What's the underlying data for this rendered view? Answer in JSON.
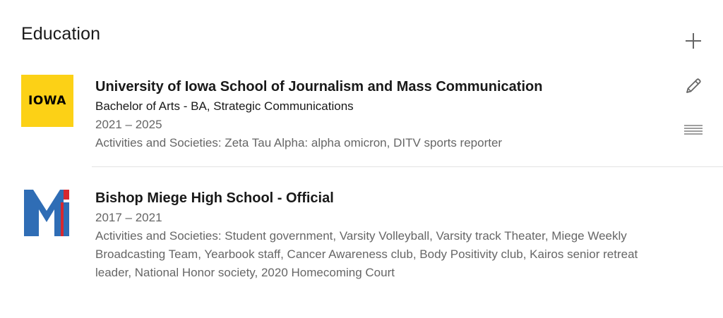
{
  "section": {
    "title": "Education"
  },
  "actions": {
    "add_icon": "plus-icon",
    "edit_icon": "pencil-icon",
    "reorder_icon": "drag-handle-icon"
  },
  "education": [
    {
      "logo_text": "IOWA",
      "logo_color": "#fcd116",
      "school": "University of Iowa School of Journalism and Mass Communication",
      "degree": "Bachelor of Arts - BA, Strategic Communications",
      "dates": "2021 – 2025",
      "activities": "Activities and Societies: Zeta Tau Alpha: alpha omicron, DITV sports reporter"
    },
    {
      "logo_colors": [
        "#2f6db5",
        "#d7282f"
      ],
      "school": "Bishop Miege High School - Official",
      "dates": "2017 – 2021",
      "activities": "Activities and Societies: Student government, Varsity Volleyball, Varsity track Theater, Miege Weekly Broadcasting Team, Yearbook staff, Cancer Awareness club, Body Positivity club, Kairos senior retreat leader, National Honor society, 2020 Homecoming Court"
    }
  ]
}
